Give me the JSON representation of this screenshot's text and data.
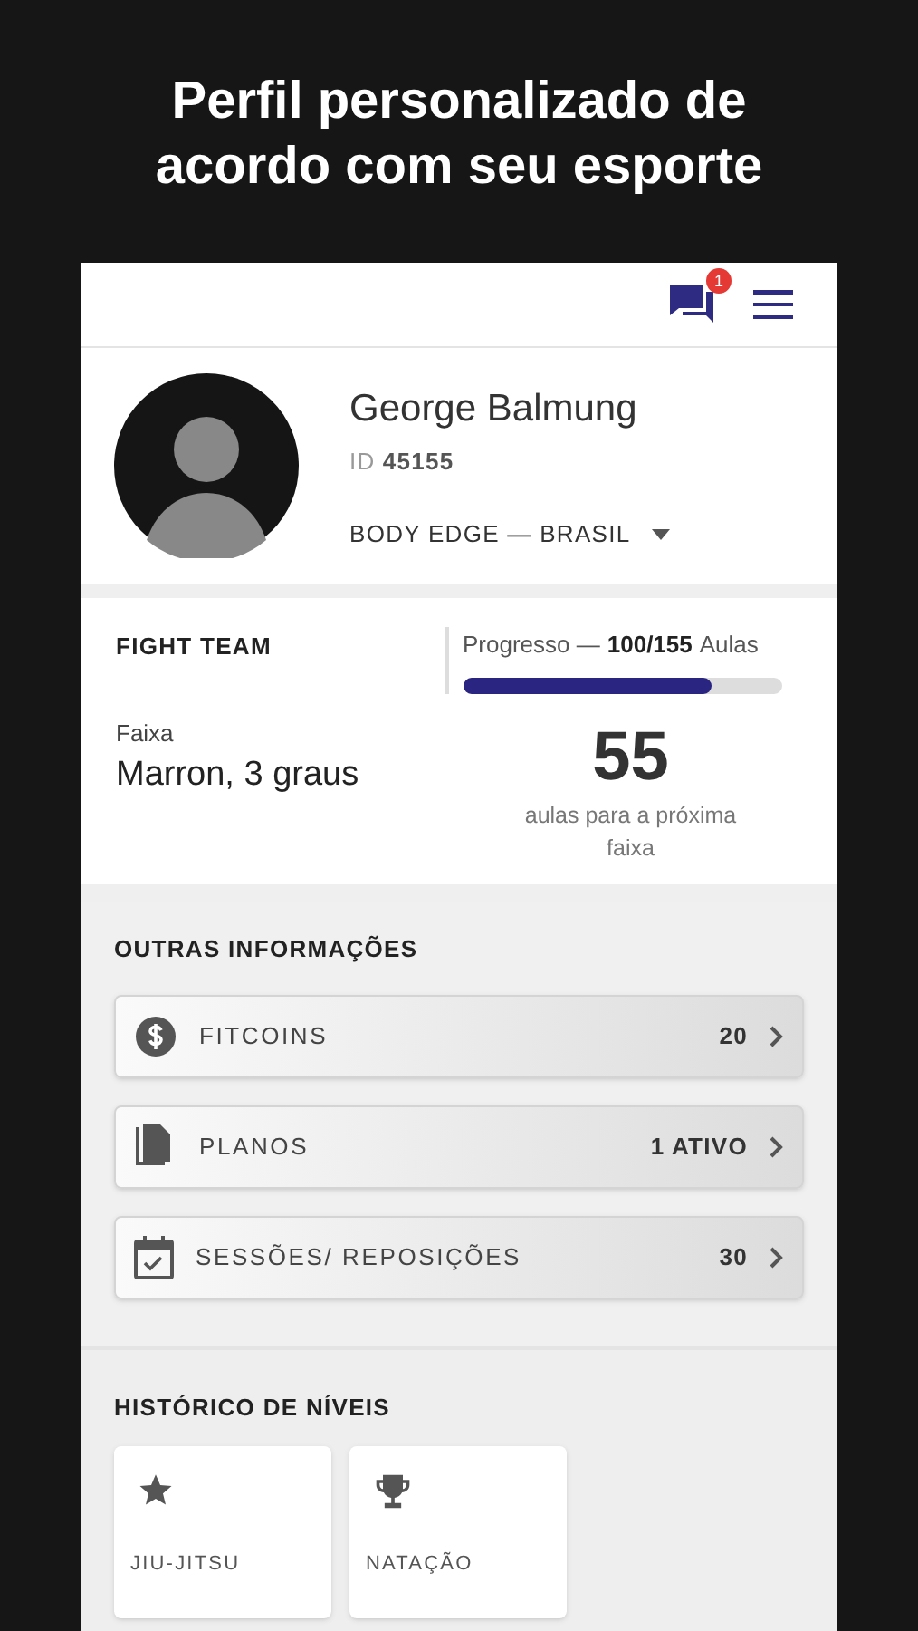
{
  "headline": "Perfil personalizado de acordo com seu esporte",
  "top_bar": {
    "notification_count": "1"
  },
  "profile": {
    "name": "George Balmung",
    "id_label": "ID",
    "id_value": "45155",
    "gym": "BODY EDGE — BRASIL"
  },
  "team": {
    "title": "FIGHT TEAM",
    "progress_label": "Progresso —",
    "progress_value": "100/155",
    "progress_unit": "Aulas",
    "level": 0.78,
    "belt_label": "Faixa",
    "belt_value": "Marron, 3 graus",
    "remaining": "55",
    "remaining_caption": "aulas para a próxima faixa"
  },
  "other_info": {
    "title": "OUTRAS INFORMAÇÕES",
    "items": [
      {
        "kind": "coin",
        "label": "FITCOINS",
        "value": "20"
      },
      {
        "kind": "document",
        "label": "PLANOS",
        "value": "1 ATIVO"
      },
      {
        "kind": "calendar",
        "label": "SESSÕES/ REPOSIÇÕES",
        "value": "30"
      }
    ]
  },
  "level_history": {
    "title": "HISTÓRICO DE NÍVEIS",
    "items": [
      {
        "kind": "star",
        "label": "JIU-JITSU"
      },
      {
        "kind": "trophy",
        "label": "NATAÇÃO"
      }
    ]
  }
}
